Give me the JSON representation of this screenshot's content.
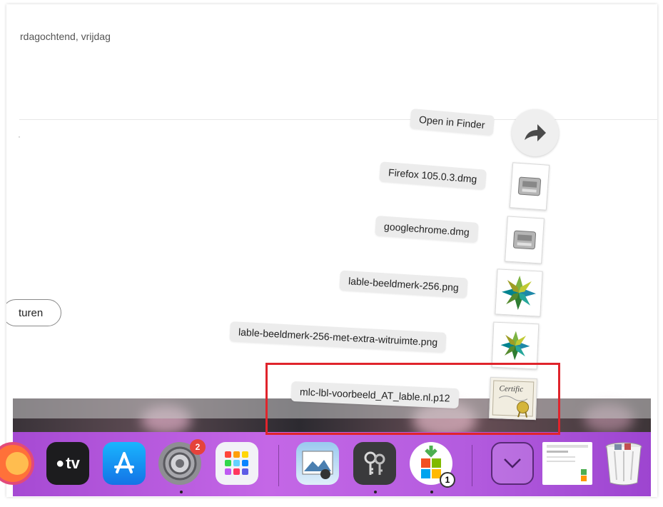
{
  "window": {
    "subtitle": "rdagochtend, vrijdag",
    "partial_mark": "·",
    "pill_button_label": "turen"
  },
  "stack": {
    "open_in_finder_label": "Open in Finder",
    "items": [
      {
        "label": "Firefox 105.0.3.dmg",
        "icon": "disk-image-icon"
      },
      {
        "label": "googlechrome.dmg",
        "icon": "disk-image-icon"
      },
      {
        "label": "lable-beeldmerk-256.png",
        "icon": "image-thumbnail-icon"
      },
      {
        "label": "lable-beeldmerk-256-met-extra-witruimte.png",
        "icon": "image-thumbnail-icon"
      },
      {
        "label": "mlc-lbl-voorbeeld_AT_lable.nl.p12",
        "icon": "certificate-icon"
      }
    ],
    "certificate_icon_text": "Certific"
  },
  "dock": {
    "appletv_label": "tv",
    "system_settings_badge": "2",
    "download_badge": "1"
  },
  "colors": {
    "highlight": "#e0242c",
    "dock_purple": "#b45cdf",
    "badge_red": "#e5433b"
  }
}
